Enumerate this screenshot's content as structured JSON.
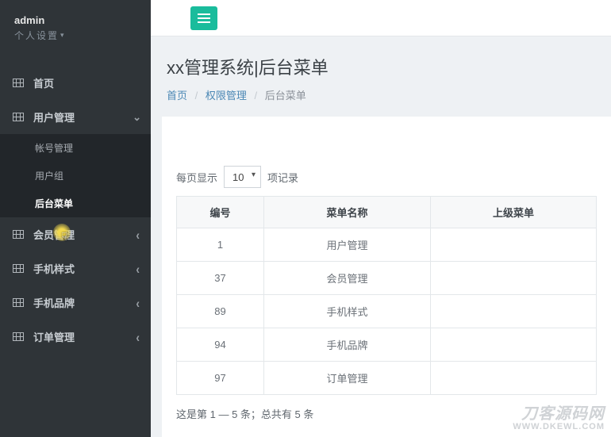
{
  "user": {
    "name": "admin",
    "settings_label": "个人设置"
  },
  "nav": {
    "home": "首页",
    "user_mgmt": {
      "label": "用户管理",
      "children": {
        "account": "帐号管理",
        "group": "用户组",
        "menu": "后台菜单"
      }
    },
    "member": "会员管理",
    "phone_style": "手机样式",
    "phone_brand": "手机品牌",
    "order": "订单管理"
  },
  "page": {
    "title": "xx管理系统|后台菜单",
    "breadcrumb": {
      "home": "首页",
      "section": "权限管理",
      "current": "后台菜单"
    }
  },
  "table": {
    "length_prefix": "每页显示",
    "length_value": "10",
    "length_suffix": "项记录",
    "headers": {
      "id": "编号",
      "name": "菜单名称",
      "parent": "上级菜单"
    },
    "rows": [
      {
        "id": "1",
        "name": "用户管理",
        "parent": ""
      },
      {
        "id": "37",
        "name": "会员管理",
        "parent": ""
      },
      {
        "id": "89",
        "name": "手机样式",
        "parent": ""
      },
      {
        "id": "94",
        "name": "手机品牌",
        "parent": ""
      },
      {
        "id": "97",
        "name": "订单管理",
        "parent": ""
      }
    ],
    "info": "这是第 1 — 5 条；总共有 5 条"
  },
  "watermark": {
    "line1": "刀客源码网",
    "line2": "WWW.DKEWL.COM"
  }
}
